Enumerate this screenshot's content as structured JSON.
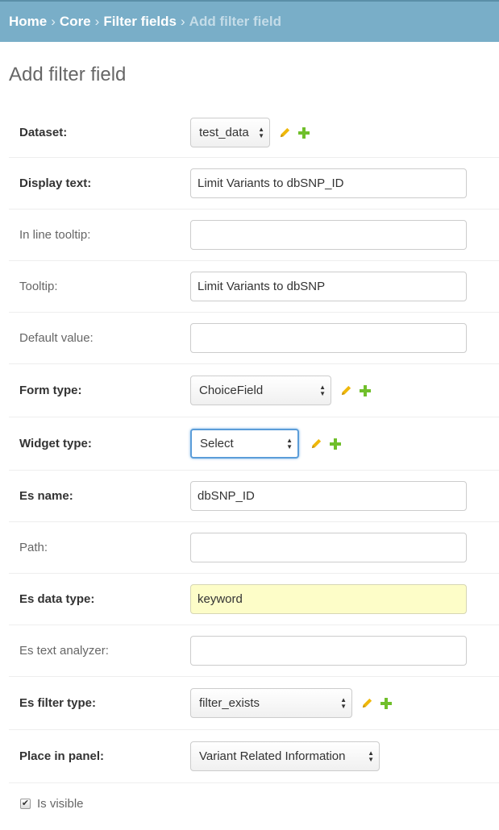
{
  "breadcrumbs": {
    "home": "Home",
    "core": "Core",
    "filter_fields": "Filter fields",
    "current": "Add filter field",
    "separator": "›"
  },
  "page": {
    "title": "Add filter field"
  },
  "form": {
    "dataset": {
      "label": "Dataset:",
      "value": "test_data"
    },
    "display_text": {
      "label": "Display text:",
      "value": "Limit Variants to dbSNP_ID"
    },
    "in_line_tooltip": {
      "label": "In line tooltip:",
      "value": ""
    },
    "tooltip": {
      "label": "Tooltip:",
      "value": "Limit Variants to dbSNP"
    },
    "default_value": {
      "label": "Default value:",
      "value": ""
    },
    "form_type": {
      "label": "Form type:",
      "value": "ChoiceField"
    },
    "widget_type": {
      "label": "Widget type:",
      "value": "Select"
    },
    "es_name": {
      "label": "Es name:",
      "value": "dbSNP_ID"
    },
    "path": {
      "label": "Path:",
      "value": ""
    },
    "es_data_type": {
      "label": "Es data type:",
      "value": "keyword"
    },
    "es_text_analyzer": {
      "label": "Es text analyzer:",
      "value": ""
    },
    "es_filter_type": {
      "label": "Es filter type:",
      "value": "filter_exists"
    },
    "place_in_panel": {
      "label": "Place in panel:",
      "value": "Variant Related Information"
    },
    "is_visible": {
      "label": "Is visible",
      "checked": true
    }
  },
  "icons": {
    "edit": "pencil-icon",
    "add": "plus-icon",
    "pencil_color": "#efb80b",
    "plus_color": "#70bf2b"
  },
  "colors": {
    "header_bg": "#79aec8",
    "autofill_bg": "#fdfdc8",
    "focus_border": "#5b9dd9"
  }
}
